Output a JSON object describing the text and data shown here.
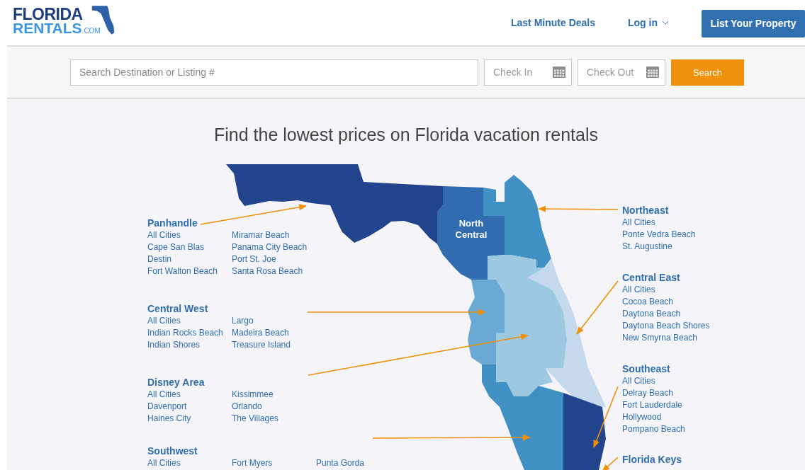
{
  "header": {
    "logo": {
      "line_1": "FLORIDA",
      "line_2": "RENTALS",
      "suffix": ".COM"
    },
    "nav": [
      {
        "label": "Last Minute Deals",
        "kind": "link"
      },
      {
        "label": "Log in",
        "kind": "dropdown"
      }
    ],
    "cta": "List Your Property"
  },
  "search": {
    "destination": {
      "placeholder": "Search Destination or Listing #"
    },
    "check_in": {
      "placeholder": "Check In"
    },
    "check_out": {
      "placeholder": "Check Out"
    },
    "button": "Search"
  },
  "title": "Find the lowest prices on Florida vacation rentals",
  "map": {
    "label": "North Central"
  },
  "regions": [
    {
      "name": "Panhandle",
      "columns": [
        [
          "All Cities",
          "Cape San Blas",
          "Destin",
          "Fort Walton Beach"
        ],
        [
          "Miramar Beach",
          "Panama City Beach",
          "Port St. Joe",
          "Santa Rosa Beach"
        ]
      ]
    },
    {
      "name": "Central West",
      "columns": [
        [
          "All Cities",
          "Indian Rocks Beach",
          "Indian Shores"
        ],
        [
          "Largo",
          "Madeira Beach",
          "Treasure Island"
        ]
      ]
    },
    {
      "name": "Disney Area",
      "columns": [
        [
          "All Cities",
          "Davenport",
          "Haines City"
        ],
        [
          "Kissimmee",
          "Orlando",
          "The Villages"
        ]
      ]
    },
    {
      "name": "Southwest",
      "columns": [
        [
          "All Cities"
        ],
        [
          "Fort Myers"
        ],
        [
          "Punta Gorda"
        ]
      ]
    },
    {
      "name": "Northeast",
      "columns": [
        [
          "All Cities",
          "Ponte Vedra Beach",
          "St. Augustine"
        ]
      ]
    },
    {
      "name": "Central East",
      "columns": [
        [
          "All Cities",
          "Cocoa Beach",
          "Daytona Beach",
          "Daytona Beach Shores",
          "New Smyrna Beach"
        ]
      ]
    },
    {
      "name": "Southeast",
      "columns": [
        [
          "All Cities",
          "Delray Beach",
          "Fort Lauderdale",
          "Hollywood",
          "Pompano Beach"
        ]
      ]
    },
    {
      "name": "Florida Keys"
    }
  ]
}
